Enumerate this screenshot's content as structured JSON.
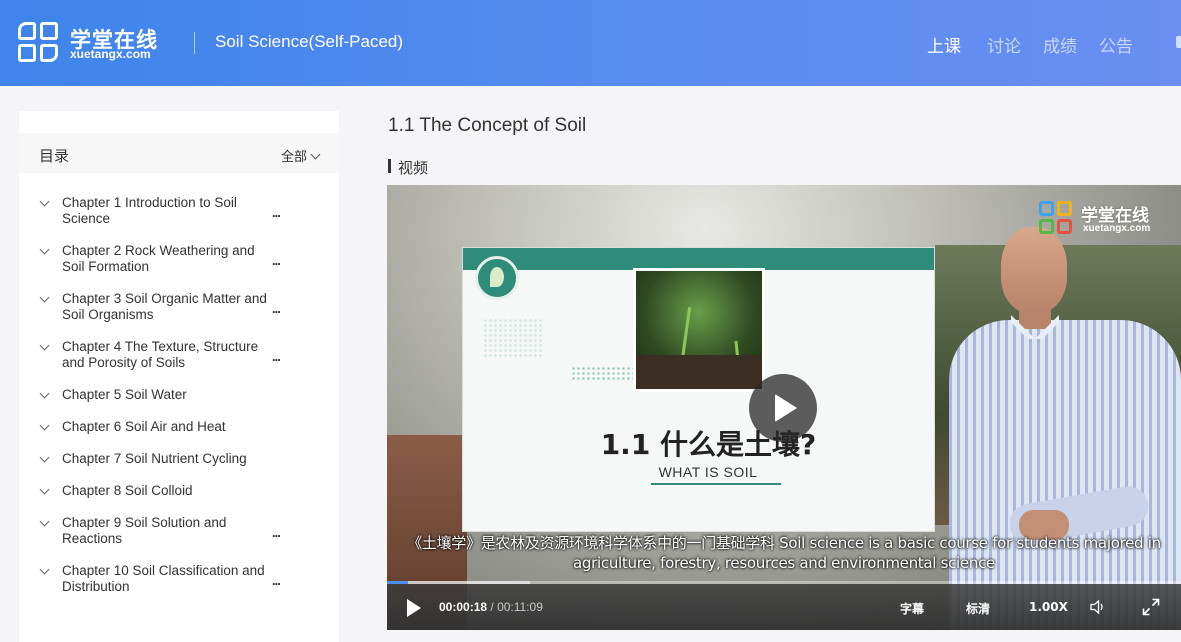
{
  "header": {
    "brand_cn": "学堂在线",
    "brand_en": "xuetangx.com",
    "course_title": "Soil Science(Self-Paced)",
    "nav": [
      {
        "label": "上课",
        "active": true
      },
      {
        "label": "讨论",
        "active": false
      },
      {
        "label": "成绩",
        "active": false
      },
      {
        "label": "公告",
        "active": false
      }
    ]
  },
  "sidebar": {
    "title": "目录",
    "filter_label": "全部",
    "chapters": [
      {
        "label": "Chapter 1 Introduction to Soil Science",
        "more": "..."
      },
      {
        "label": "Chapter 2 Rock Weathering and Soil Formation",
        "more": "..."
      },
      {
        "label": "Chapter 3 Soil Organic Matter and Soil Organisms",
        "more": "..."
      },
      {
        "label": "Chapter 4 The Texture, Structure and Porosity of Soils",
        "more": "..."
      },
      {
        "label": "Chapter 5 Soil Water"
      },
      {
        "label": "Chapter 6 Soil Air and Heat"
      },
      {
        "label": "Chapter 7 Soil Nutrient Cycling"
      },
      {
        "label": "Chapter 8 Soil Colloid"
      },
      {
        "label": "Chapter 9 Soil Solution and Reactions",
        "more": "..."
      },
      {
        "label": "Chapter 10 Soil Classification and Distribution",
        "more": "..."
      }
    ]
  },
  "main": {
    "lesson_title": "1.1 The Concept of Soil",
    "section_label": "视频"
  },
  "video": {
    "watermark_cn": "学堂在线",
    "watermark_en": "xuetangx.com",
    "slide_heading": "1.1 什么是土壤?",
    "slide_sub": "WHAT IS SOIL",
    "subtitle": "《土壤学》是农林及资源环境科学体系中的一门基础学科 Soil science is a basic course for students majored in agriculture, forestry, resources and environmental science",
    "current_time": "00:00:18",
    "separator": " / ",
    "total_time": "00:11:09",
    "progress_fraction": 0.027,
    "buffer_fraction": 0.18,
    "subtitle_button": "字幕",
    "quality_button": "标清",
    "speed_button": "1.00X",
    "accent_color": "#4a8cf0"
  }
}
